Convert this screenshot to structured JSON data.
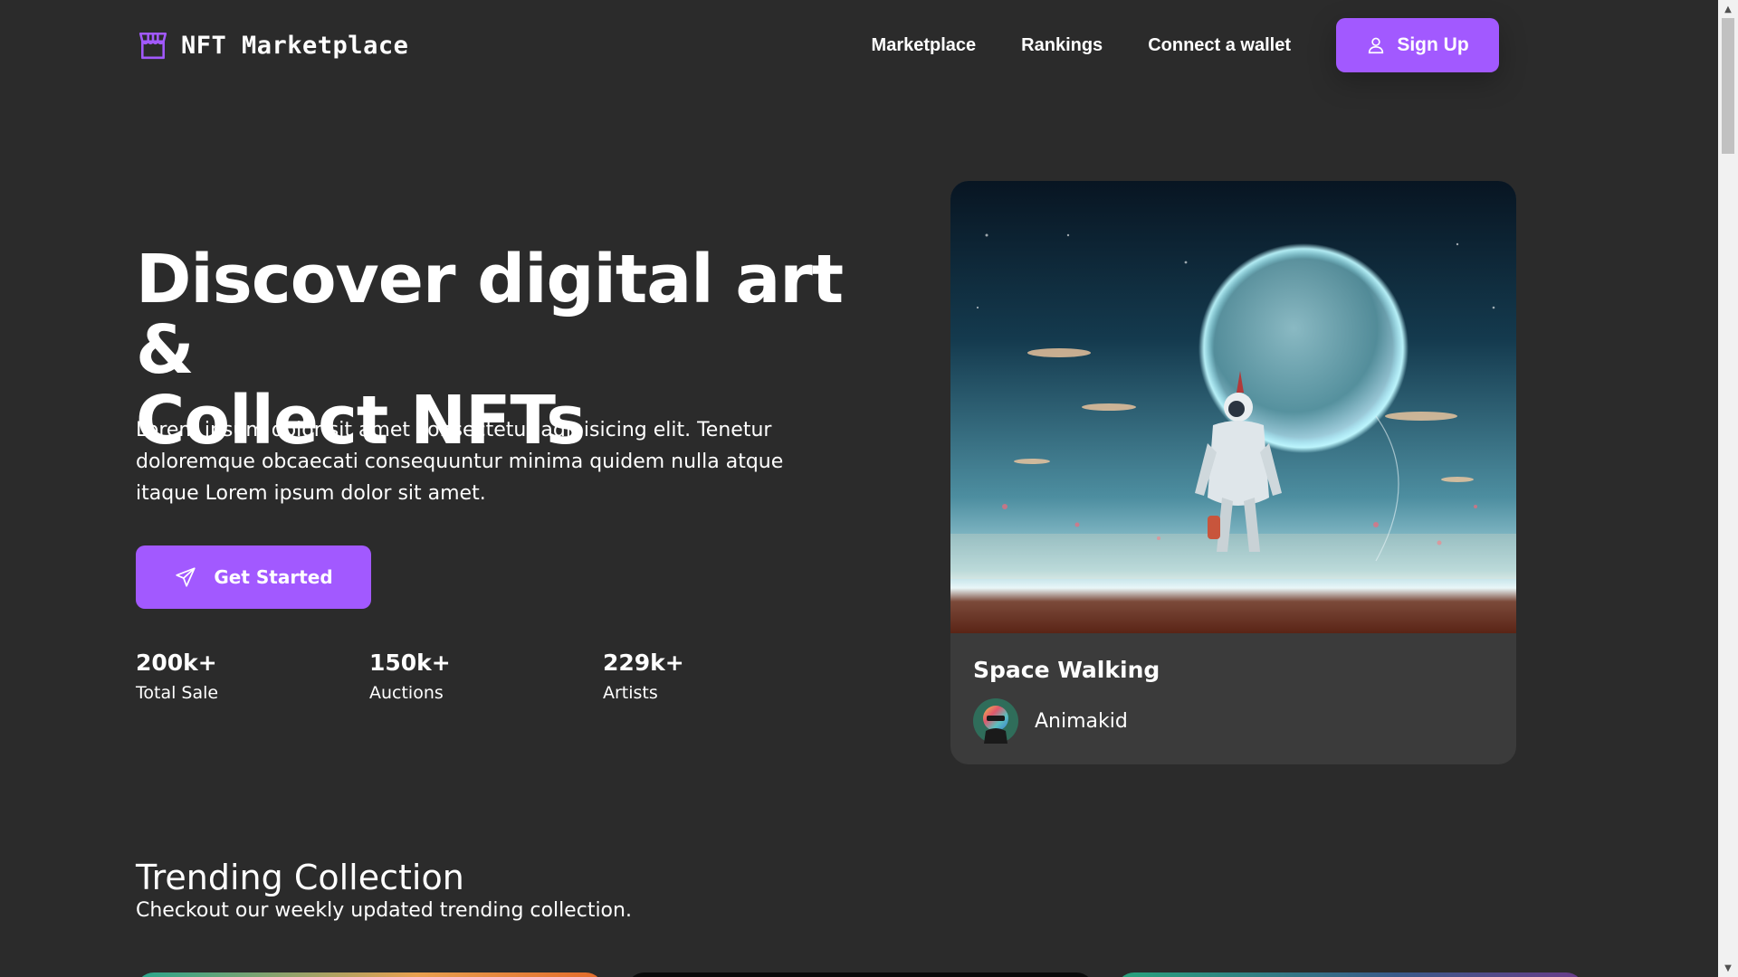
{
  "header": {
    "logo_text": "NFT Marketplace",
    "nav": {
      "marketplace": "Marketplace",
      "rankings": "Rankings",
      "connect_wallet": "Connect a wallet"
    },
    "signup_label": "Sign Up"
  },
  "hero": {
    "title_line1": "Discover digital art &",
    "title_line2": "Collect NFTs",
    "description": "Lorem ipsum dolor sit amet consectetur adipisicing elit. Tenetur doloremque obcaecati consequuntur minima quidem nulla atque itaque Lorem ipsum dolor sit amet.",
    "cta_label": "Get Started",
    "stats": [
      {
        "value": "200k+",
        "label": "Total Sale"
      },
      {
        "value": "150k+",
        "label": "Auctions"
      },
      {
        "value": "229k+",
        "label": "Artists"
      }
    ],
    "card": {
      "title": "Space Walking",
      "artist": "Animakid"
    }
  },
  "trending": {
    "title": "Trending Collection",
    "subtitle": "Checkout our weekly updated trending collection."
  },
  "colors": {
    "background": "#2b2b2b",
    "card": "#3b3b3b",
    "accent": "#a259ff",
    "text": "#ffffff"
  },
  "icons": {
    "logo": "storefront-icon",
    "signup": "user-icon",
    "cta": "paper-plane-icon",
    "scroll_up": "arrow-up-icon",
    "scroll_down": "arrow-down-icon"
  }
}
